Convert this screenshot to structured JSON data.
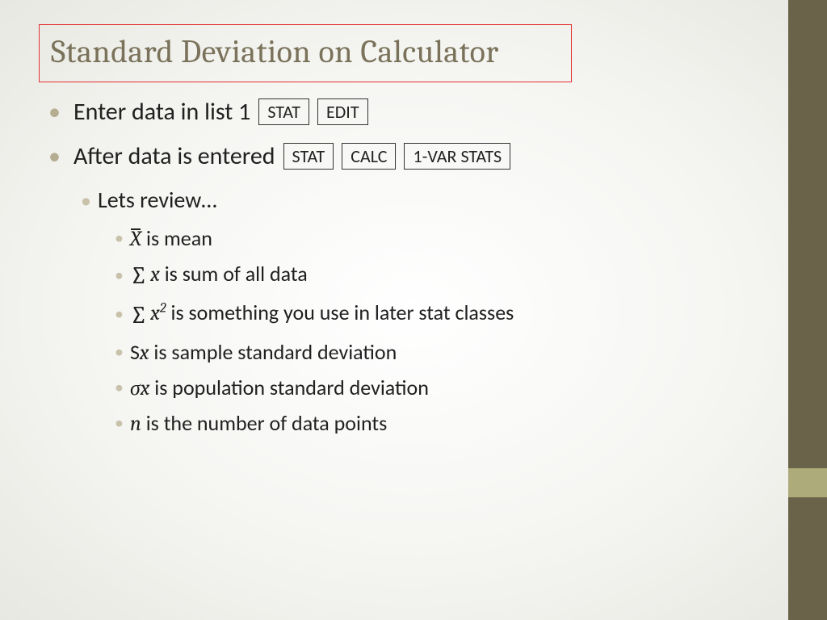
{
  "title": "Standard Deviation on Calculator",
  "bullets": {
    "line1": "Enter data in list 1",
    "line1_keys": [
      "STAT",
      "EDIT"
    ],
    "line2": "After data is entered",
    "line2_keys": [
      "STAT",
      "CALC",
      "1-VAR STATS"
    ],
    "review_intro": "Lets review…",
    "items": {
      "mean_text": " is mean",
      "sum_text": " is sum of all data",
      "sumsq_text": " is something you use in later stat classes",
      "sx_prefix": "S",
      "sx_var": "x",
      "sx_text": " is sample standard deviation",
      "sigmax_text": " is population standard deviation",
      "n_var": "n",
      "n_text": " is the number of data points"
    }
  }
}
